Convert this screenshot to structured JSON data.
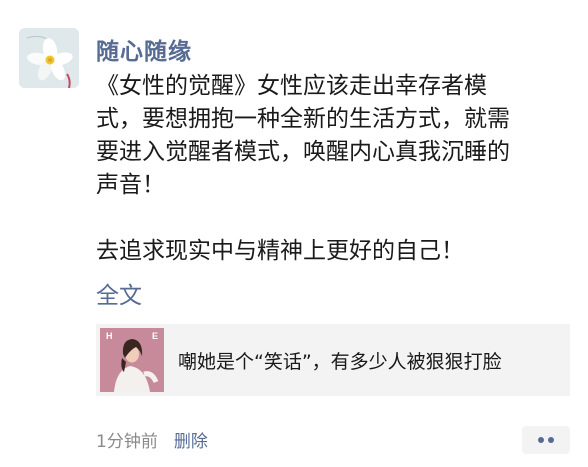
{
  "post": {
    "username": "随心随缘",
    "text_lines": [
      "《女性的觉醒》女性应该走出幸存者模",
      "式，要想拥抱一种全新的生活方式，就需",
      "要进入觉醒者模式，唤醒内心真我沉睡的",
      "声音！",
      "去追求现实中与精神上更好的自己！"
    ],
    "full_text_label": "全文"
  },
  "link_card": {
    "title": "嘲她是个“笑话”，有多少人被狠狠打脸",
    "thumb_letter_left": "H",
    "thumb_letter_right": "E"
  },
  "footer": {
    "time": "1分钟前",
    "delete_label": "删除"
  },
  "colors": {
    "link_blue": "#576b95",
    "card_bg": "#f3f3f3",
    "meta_gray": "#8a8a8a"
  },
  "icons": {
    "avatar": "white-flower",
    "more": "two-dots-icon"
  }
}
